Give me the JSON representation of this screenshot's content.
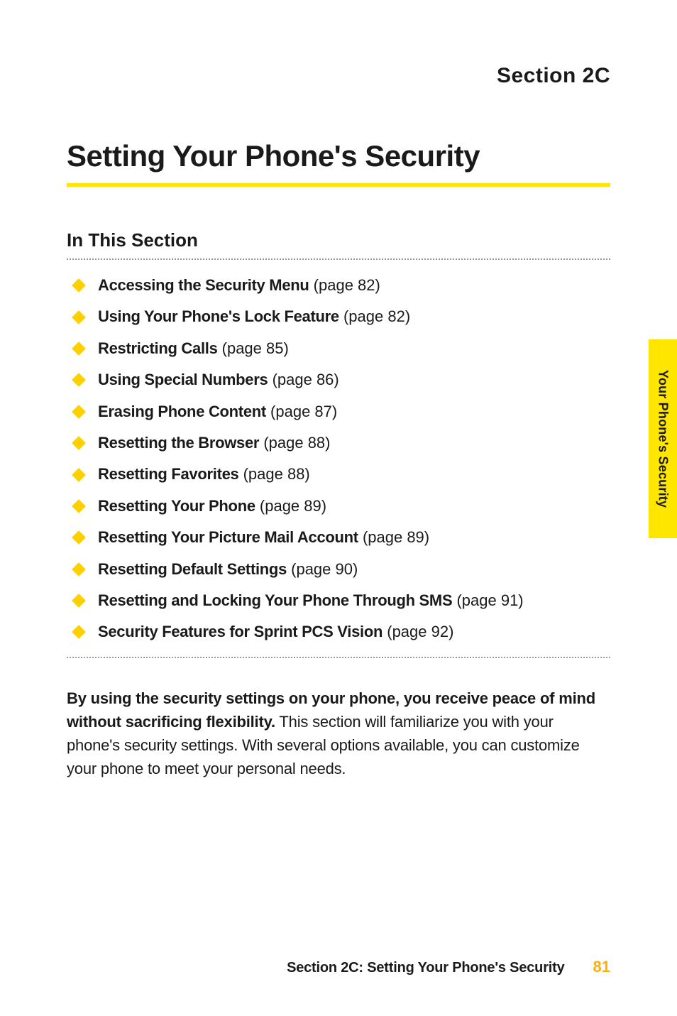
{
  "section_label": "Section 2C",
  "title": "Setting Your Phone's Security",
  "subheading": "In This Section",
  "toc": [
    {
      "bold": "Accessing the Security Menu",
      "ref": " (page 82)"
    },
    {
      "bold": "Using Your Phone's Lock Feature",
      "ref": " (page 82)"
    },
    {
      "bold": "Restricting Calls",
      "ref": " (page 85)"
    },
    {
      "bold": "Using Special Numbers",
      "ref": " (page 86)"
    },
    {
      "bold": "Erasing Phone Content",
      "ref": " (page 87)"
    },
    {
      "bold": "Resetting the Browser",
      "ref": " (page 88)"
    },
    {
      "bold": "Resetting Favorites",
      "ref": " (page 88)"
    },
    {
      "bold": "Resetting Your Phone",
      "ref": " (page 89)"
    },
    {
      "bold": "Resetting Your Picture Mail Account",
      "ref": " (page 89)"
    },
    {
      "bold": "Resetting Default Settings",
      "ref": " (page 90)"
    },
    {
      "bold": "Resetting and Locking Your Phone Through SMS",
      "ref": " (page 91)"
    },
    {
      "bold": "Security Features for Sprint PCS Vision",
      "ref": " (page 92)"
    }
  ],
  "paragraph": {
    "lead": "By using the security settings on your phone, you receive peace of mind without sacrificing flexibility.",
    "rest": " This section will familiarize you with your phone's security settings. With several options available, you can customize your phone to meet your personal needs."
  },
  "side_tab": "Your Phone's Security",
  "footer": {
    "title": "Section 2C: Setting Your Phone's Security",
    "page": "81"
  }
}
